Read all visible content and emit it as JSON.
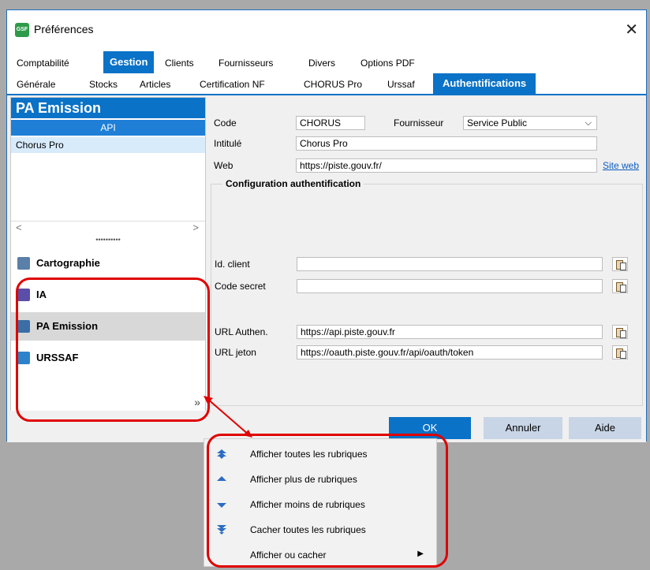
{
  "window": {
    "title": "Préférences",
    "close_label": "✕",
    "app_icon_text": "GSF"
  },
  "top_tabs": [
    {
      "label": "Comptabilité",
      "active": false
    },
    {
      "label": "Gestion",
      "active": true
    },
    {
      "label": "Clients",
      "active": false
    },
    {
      "label": "Fournisseurs",
      "active": false
    },
    {
      "label": "Divers",
      "active": false
    },
    {
      "label": "Options PDF",
      "active": false
    }
  ],
  "sub_tabs": [
    {
      "label": "Générale",
      "active": false
    },
    {
      "label": "Stocks",
      "active": false
    },
    {
      "label": "Articles",
      "active": false
    },
    {
      "label": "Certification NF",
      "active": false
    },
    {
      "label": "CHORUS Pro",
      "active": false
    },
    {
      "label": "Urssaf",
      "active": false
    },
    {
      "label": "Authentifications",
      "active": true
    }
  ],
  "left_panel": {
    "header": "PA Emission",
    "column_header": "API",
    "rows": [
      "Chorus Pro"
    ],
    "scroll_left": "<",
    "scroll_right": ">",
    "splitter": "••••••••••",
    "nav_items": [
      {
        "label": "Cartographie",
        "icon": "map-icon",
        "color": "#5a7fa8",
        "selected": false
      },
      {
        "label": "IA",
        "icon": "ai-chip-icon",
        "color": "#5b4ea8",
        "selected": false
      },
      {
        "label": "PA Emission",
        "icon": "document-icon",
        "color": "#3a6ea5",
        "selected": true
      },
      {
        "label": "URSSAF",
        "icon": "urssaf-icon",
        "color": "#2c83c9",
        "selected": false
      }
    ],
    "more_chevron": "»"
  },
  "form": {
    "code_label": "Code",
    "code_value": "CHORUS",
    "fournisseur_label": "Fournisseur",
    "fournisseur_value": "Service Public",
    "intitule_label": "Intitulé",
    "intitule_value": "Chorus Pro",
    "web_label": "Web",
    "web_value": "https://piste.gouv.fr/",
    "site_web_link": "Site web",
    "group_title": "Configuration authentification",
    "client_id_label": "Id. client",
    "client_id_value": "",
    "secret_label": "Code secret",
    "secret_value": "",
    "url_auth_label": "URL Authen.",
    "url_auth_value": "https://api.piste.gouv.fr",
    "url_token_label": "URL jeton",
    "url_token_value": "https://oauth.piste.gouv.fr/api/oauth/token"
  },
  "buttons": {
    "ok": "OK",
    "cancel": "Annuler",
    "help": "Aide"
  },
  "context_menu": [
    {
      "label": "Afficher toutes les rubriques",
      "icon": "show-all-icon",
      "submenu": false
    },
    {
      "label": "Afficher plus de rubriques",
      "icon": "show-more-icon",
      "submenu": false
    },
    {
      "label": "Afficher moins de rubriques",
      "icon": "show-less-icon",
      "submenu": false
    },
    {
      "label": "Cacher toutes les rubriques",
      "icon": "hide-all-icon",
      "submenu": false
    },
    {
      "label": "Afficher ou cacher",
      "icon": "",
      "submenu": true
    }
  ],
  "colors": {
    "accent": "#0a72c7",
    "highlight": "#e00000"
  }
}
